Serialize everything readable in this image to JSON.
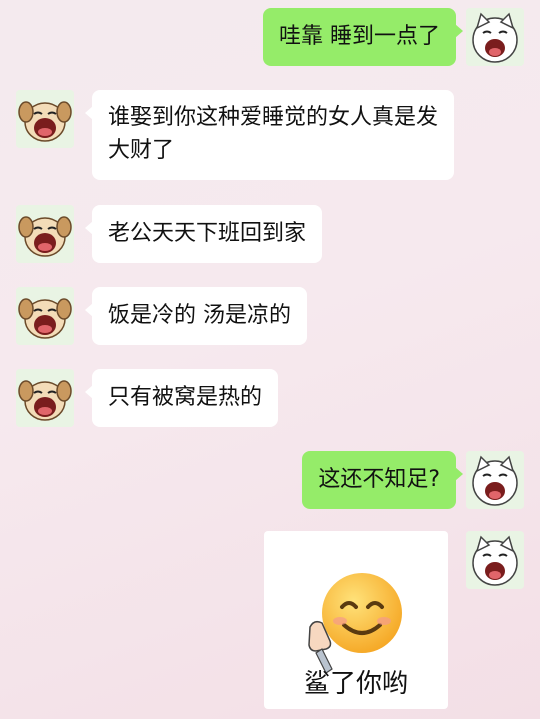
{
  "messages": [
    {
      "side": "right",
      "text": "哇靠 睡到一点了"
    },
    {
      "side": "left",
      "text": "谁娶到你这种爱睡觉的女人真是发大财了"
    },
    {
      "side": "left",
      "text": "老公天天下班回到家"
    },
    {
      "side": "left",
      "text": "饭是冷的 汤是凉的"
    },
    {
      "side": "left",
      "text": "只有被窝是热的"
    },
    {
      "side": "right",
      "text": "这还不知足?"
    }
  ],
  "sticker": {
    "caption": "鲨了你哟",
    "emoji": "😊"
  },
  "avatars": {
    "self": "white-cat-crying-avatar",
    "other": "dog-crying-avatar"
  }
}
